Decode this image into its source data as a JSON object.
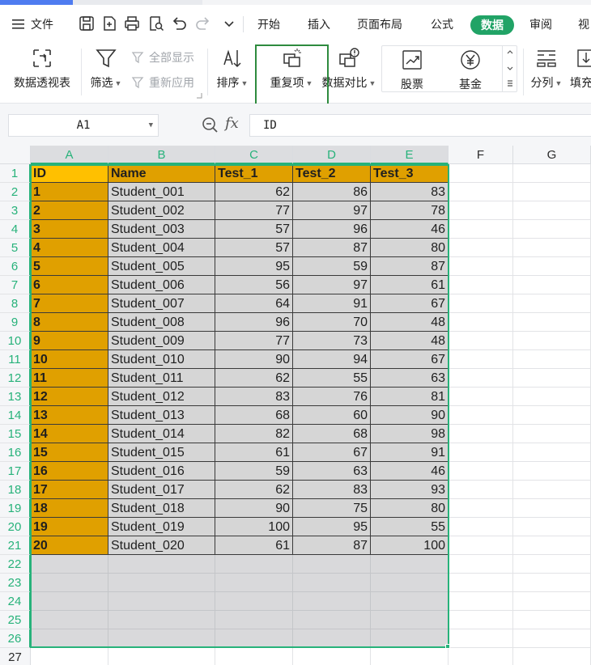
{
  "menubar": {
    "file_label": "文件",
    "tabs": [
      "开始",
      "插入",
      "页面布局",
      "公式",
      "数据",
      "审阅",
      "视"
    ],
    "active_tab": "数据"
  },
  "ribbon": {
    "pivot_label": "数据透视表",
    "filter_label": "筛选",
    "show_all_label": "全部显示",
    "reapply_label": "重新应用",
    "sort_label": "排序",
    "duplicates_label": "重复项",
    "compare_label": "数据对比",
    "stock_label": "股票",
    "fund_label": "基金",
    "split_label": "分列",
    "fill_label": "填充"
  },
  "formula_bar": {
    "name_box": "A1",
    "fx_label": "fx",
    "content": "ID"
  },
  "sheet": {
    "columns": [
      "A",
      "B",
      "C",
      "D",
      "E",
      "F",
      "G"
    ],
    "row_numbers": [
      "1",
      "2",
      "3",
      "4",
      "5",
      "6",
      "7",
      "8",
      "9",
      "10",
      "11",
      "12",
      "13",
      "14",
      "15",
      "16",
      "17",
      "18",
      "19",
      "20",
      "21",
      "22",
      "23",
      "24",
      "25",
      "26",
      "27"
    ],
    "header": [
      "ID",
      "Name",
      "Test_1",
      "Test_2",
      "Test_3"
    ],
    "rows": [
      [
        "1",
        "Student_001",
        "62",
        "86",
        "83"
      ],
      [
        "2",
        "Student_002",
        "77",
        "97",
        "78"
      ],
      [
        "3",
        "Student_003",
        "57",
        "96",
        "46"
      ],
      [
        "4",
        "Student_004",
        "57",
        "87",
        "80"
      ],
      [
        "5",
        "Student_005",
        "95",
        "59",
        "87"
      ],
      [
        "6",
        "Student_006",
        "56",
        "97",
        "61"
      ],
      [
        "7",
        "Student_007",
        "64",
        "91",
        "67"
      ],
      [
        "8",
        "Student_008",
        "96",
        "70",
        "48"
      ],
      [
        "9",
        "Student_009",
        "77",
        "73",
        "48"
      ],
      [
        "10",
        "Student_010",
        "90",
        "94",
        "67"
      ],
      [
        "11",
        "Student_011",
        "62",
        "55",
        "63"
      ],
      [
        "12",
        "Student_012",
        "83",
        "76",
        "81"
      ],
      [
        "13",
        "Student_013",
        "68",
        "60",
        "90"
      ],
      [
        "14",
        "Student_014",
        "82",
        "68",
        "98"
      ],
      [
        "15",
        "Student_015",
        "61",
        "67",
        "91"
      ],
      [
        "16",
        "Student_016",
        "59",
        "63",
        "46"
      ],
      [
        "17",
        "Student_017",
        "62",
        "83",
        "93"
      ],
      [
        "18",
        "Student_018",
        "90",
        "75",
        "80"
      ],
      [
        "19",
        "Student_019",
        "100",
        "95",
        "55"
      ],
      [
        "20",
        "Student_020",
        "61",
        "87",
        "100"
      ]
    ]
  },
  "colors": {
    "accent_green": "#21a366",
    "selection_green": "#27b27a",
    "header_fill": "#e0a000",
    "active_cell_fill": "#ffc000",
    "data_fill": "#d6d6d6",
    "highlight_box": "#2e8b3e"
  }
}
